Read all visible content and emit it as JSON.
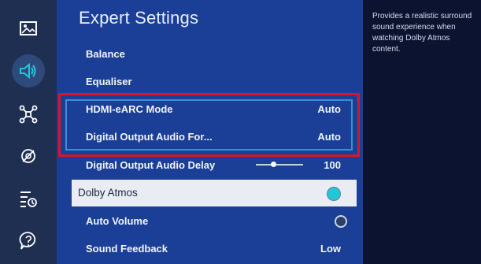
{
  "sidebar": {
    "icons": [
      "picture-icon",
      "sound-icon",
      "connection-icon",
      "broadcasting-icon",
      "general-settings-icon",
      "support-icon"
    ]
  },
  "page": {
    "title": "Expert Settings"
  },
  "menu": [
    {
      "label": "Balance",
      "value": ""
    },
    {
      "label": "Equaliser",
      "value": ""
    },
    {
      "label": "HDMI-eARC Mode",
      "value": "Auto"
    },
    {
      "label": "Digital Output Audio For...",
      "value": "Auto"
    },
    {
      "label": "Digital Output Audio Delay",
      "value": "100"
    },
    {
      "label": "Dolby Atmos",
      "value": ""
    },
    {
      "label": "Auto Volume",
      "value": ""
    },
    {
      "label": "Sound Feedback",
      "value": "Low"
    }
  ],
  "description": "Provides a realistic surround sound experience when watching Dolby Atmos content.",
  "slider": {
    "value": 0.38
  },
  "colors": {
    "accent_toggle": "#21c7d8",
    "highlight": "#d9152b",
    "panel": "#1b3f97"
  }
}
